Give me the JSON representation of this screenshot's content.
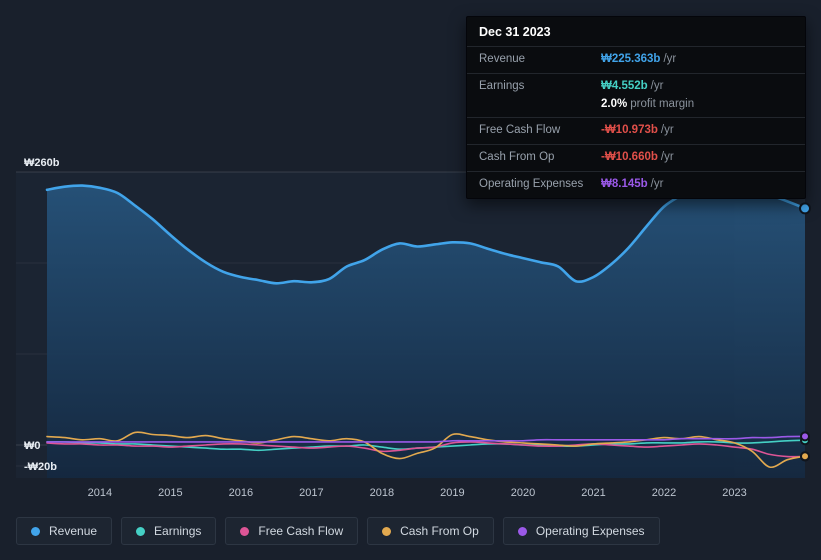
{
  "tooltip": {
    "date": "Dec 31 2023",
    "rows": {
      "revenue": {
        "label": "Revenue",
        "value": "₩225.363b",
        "suffix": "/yr"
      },
      "earnings": {
        "label": "Earnings",
        "value": "₩4.552b",
        "suffix": "/yr",
        "margin_value": "2.0%",
        "margin_label": "profit margin"
      },
      "free_cash_flow": {
        "label": "Free Cash Flow",
        "value": "-₩10.973b",
        "suffix": "/yr"
      },
      "cash_from_op": {
        "label": "Cash From Op",
        "value": "-₩10.660b",
        "suffix": "/yr"
      },
      "operating_expenses": {
        "label": "Operating Expenses",
        "value": "₩8.145b",
        "suffix": "/yr"
      }
    }
  },
  "colors": {
    "revenue": "#41a4ea",
    "earnings": "#45d0c5",
    "negative": "#e2504a",
    "operating_expenses": "#9b59e8",
    "free_cash_flow": "#dd5596",
    "cash_from_op": "#e2a94f",
    "margin": "#ffffff"
  },
  "chart_data": {
    "type": "area",
    "unit": "billions KRW (₩b)",
    "x_start": 2013.25,
    "x_step": 0.25,
    "x_ticks": [
      2014,
      2015,
      2016,
      2017,
      2018,
      2019,
      2020,
      2021,
      2022,
      2023
    ],
    "y_ticks": [
      {
        "label": "₩260b",
        "value": 260
      },
      {
        "label": "₩0",
        "value": 0
      },
      {
        "label": "-₩20b",
        "value": -20
      }
    ],
    "grid_values": [
      260,
      173.33,
      86.67,
      0,
      -20
    ],
    "ylim": [
      -31,
      260
    ],
    "highlight_from_x": 2023,
    "legend_position": "bottom",
    "series": [
      {
        "name": "Revenue",
        "color": "#41a4ea",
        "area": true,
        "values": [
          243,
          246,
          247,
          245,
          240,
          228,
          215,
          200,
          186,
          174,
          165,
          160,
          157,
          154,
          156,
          155,
          158,
          170,
          176,
          186,
          192,
          189,
          191,
          193,
          192,
          187,
          182,
          178,
          174,
          170,
          156,
          160,
          172,
          188,
          208,
          227,
          238,
          248,
          245,
          242,
          241,
          238,
          232,
          225.363
        ]
      },
      {
        "name": "Earnings",
        "color": "#45d0c5",
        "values": [
          3,
          3,
          2,
          2,
          1,
          1,
          0,
          -1,
          -2,
          -3,
          -4,
          -4,
          -5,
          -4,
          -3,
          -2,
          -1,
          -1,
          0,
          -2,
          -4,
          -3,
          -2,
          -1,
          0,
          1,
          1,
          0,
          0,
          -1,
          -1,
          0,
          1,
          1,
          2,
          2,
          2,
          3,
          3,
          2,
          2,
          3,
          4,
          4.552
        ]
      },
      {
        "name": "Free Cash Flow",
        "color": "#dd5596",
        "values": [
          2,
          1,
          1,
          0,
          0,
          -1,
          -1,
          -2,
          -1,
          0,
          1,
          1,
          0,
          -1,
          -2,
          -3,
          -2,
          -1,
          -3,
          -6,
          -5,
          -3,
          -2,
          2,
          3,
          2,
          1,
          0,
          -1,
          -1,
          0,
          1,
          0,
          -1,
          -2,
          -1,
          0,
          1,
          0,
          -2,
          -4,
          -9,
          -11,
          -10.973
        ]
      },
      {
        "name": "Cash From Op",
        "color": "#e2a94f",
        "values": [
          8,
          7,
          5,
          6,
          4,
          12,
          10,
          9,
          7,
          9,
          6,
          4,
          2,
          5,
          8,
          6,
          4,
          6,
          3,
          -8,
          -13,
          -8,
          -3,
          10,
          8,
          5,
          3,
          2,
          1,
          0,
          -1,
          1,
          2,
          3,
          5,
          7,
          6,
          8,
          5,
          2,
          -6,
          -21,
          -14,
          -10.66
        ]
      },
      {
        "name": "Operating Expenses",
        "color": "#9b59e8",
        "values": [
          3,
          3,
          3,
          3,
          3,
          3,
          3,
          3,
          3,
          3,
          3,
          3,
          3,
          3,
          3,
          3,
          3,
          3,
          3,
          3,
          3,
          3,
          3,
          4,
          4,
          4,
          4,
          4,
          5,
          5,
          5,
          5,
          5,
          5,
          5,
          5,
          6,
          6,
          6,
          6,
          7,
          7,
          8,
          8.145
        ]
      }
    ]
  }
}
